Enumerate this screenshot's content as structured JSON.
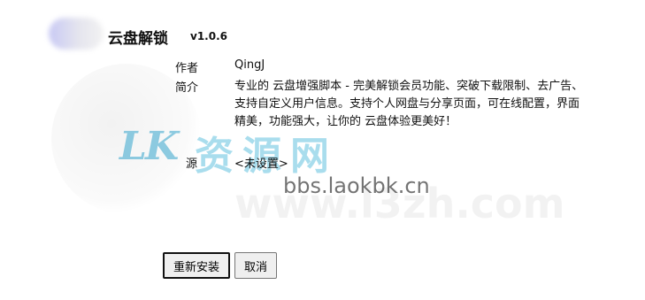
{
  "header": {
    "script_name": "云盘解锁",
    "version": "v1.0.6"
  },
  "info": {
    "author_label": "作者",
    "author_value": "QingJ",
    "description_label": "简介",
    "description_value": "专业的  云盘增强脚本 - 完美解锁会员功能、突破下载限制、去广告、支持自定义用户信息。支持个人网盘与分享页面，可在线配置，界面精美，功能强大，让你的  云盘体验更美好！",
    "source_label": "源",
    "source_value": "<未设置>"
  },
  "buttons": {
    "reinstall_label": "重新安装",
    "cancel_label": "取消"
  },
  "watermark": {
    "brand_mark": "LK",
    "brand_text": "资源网",
    "url_primary": "bbs.laokbk.cn",
    "url_secondary": "www.l3zh.com"
  },
  "colors": {
    "watermark_accent": "#28aad2"
  }
}
